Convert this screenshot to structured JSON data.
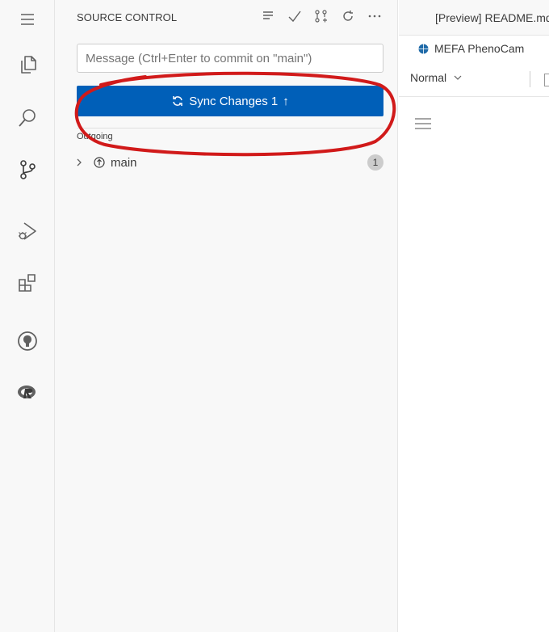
{
  "activity_bar": {
    "items": [
      {
        "name": "menu-icon"
      },
      {
        "name": "explorer-icon"
      },
      {
        "name": "search-icon"
      },
      {
        "name": "source-control-icon"
      },
      {
        "name": "run-debug-icon"
      },
      {
        "name": "extensions-icon"
      },
      {
        "name": "github-icon"
      },
      {
        "name": "r-icon"
      }
    ]
  },
  "source_control": {
    "title": "SOURCE CONTROL",
    "actions": [
      "view-as-tree-icon",
      "commit-check-icon",
      "pull-request-icon",
      "refresh-icon",
      "more-actions-icon"
    ],
    "commit_placeholder": "Message (Ctrl+Enter to commit on \"main\")",
    "sync_label": "Sync Changes 1",
    "sync_arrow": "↑",
    "outgoing_label": "Outgoing",
    "branch": {
      "name": "main",
      "count": "1"
    }
  },
  "editor": {
    "tab_title": "[Preview] README.md",
    "breadcrumb": "MEFA PhenoCam",
    "style_select": "Normal"
  },
  "colors": {
    "accent": "#005fb8",
    "annotation": "#d11a1a",
    "sidebar_bg": "#f8f8f8"
  }
}
